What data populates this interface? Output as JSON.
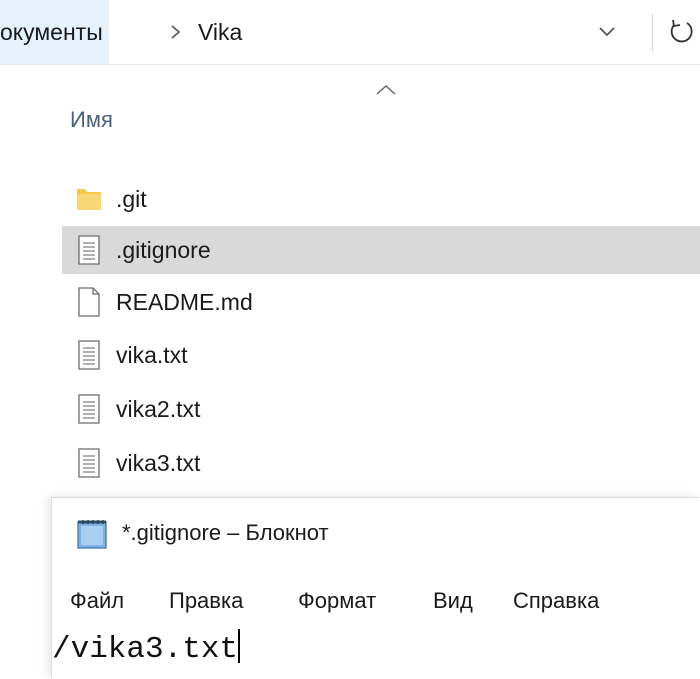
{
  "explorer": {
    "breadcrumb": [
      {
        "label": "окументы"
      },
      {
        "label": "Vika"
      }
    ],
    "column_header": "Имя",
    "files": [
      {
        "name": ".git",
        "icon": "folder-icon",
        "selected": false
      },
      {
        "name": ".gitignore",
        "icon": "text-file-icon",
        "selected": true
      },
      {
        "name": "README.md",
        "icon": "blank-file-icon",
        "selected": false
      },
      {
        "name": "vika.txt",
        "icon": "text-file-icon",
        "selected": false
      },
      {
        "name": "vika2.txt",
        "icon": "text-file-icon",
        "selected": false
      },
      {
        "name": "vika3.txt",
        "icon": "text-file-icon",
        "selected": false
      }
    ]
  },
  "notepad": {
    "title": "*.gitignore – Блокнот",
    "menu": [
      "Файл",
      "Правка",
      "Формат",
      "Вид",
      "Справка"
    ],
    "content": "/vika3.txt"
  },
  "colors": {
    "breadcrumb_highlight": "#e5f1fb",
    "selected_row": "#d9d9d9",
    "column_header_text": "#4c607a",
    "folder": "#f5c94a"
  }
}
